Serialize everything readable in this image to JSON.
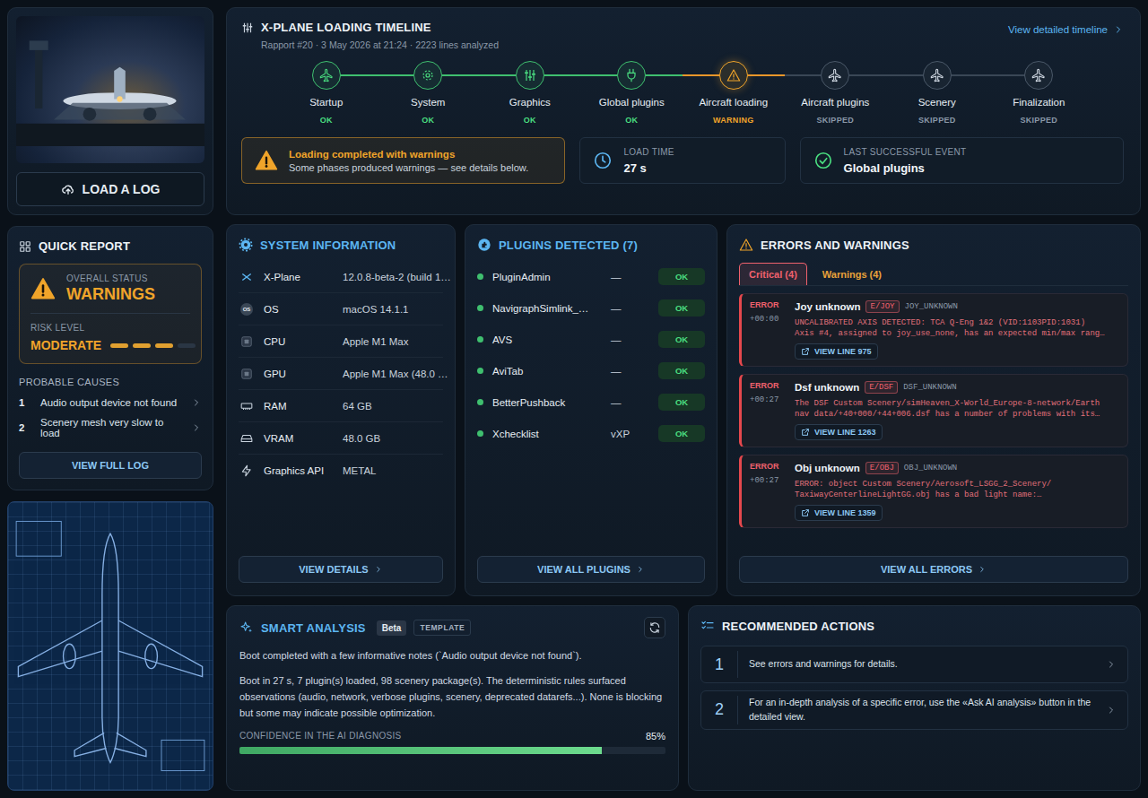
{
  "load_button": {
    "label": "LOAD A LOG"
  },
  "timeline": {
    "title": "X-PLANE LOADING TIMELINE",
    "subtitle": "Rapport #20 · 3 May 2026 at 21:24 · 2223 lines analyzed",
    "link": "View detailed timeline",
    "steps": [
      {
        "label": "Startup",
        "status": "OK",
        "kind": "ok"
      },
      {
        "label": "System",
        "status": "OK",
        "kind": "ok"
      },
      {
        "label": "Graphics",
        "status": "OK",
        "kind": "ok"
      },
      {
        "label": "Global plugins",
        "status": "OK",
        "kind": "ok"
      },
      {
        "label": "Aircraft loading",
        "status": "WARNING",
        "kind": "warning"
      },
      {
        "label": "Aircraft plugins",
        "status": "SKIPPED",
        "kind": "skipped"
      },
      {
        "label": "Scenery",
        "status": "SKIPPED",
        "kind": "skipped"
      },
      {
        "label": "Finalization",
        "status": "SKIPPED",
        "kind": "skipped"
      }
    ],
    "summary": {
      "title": "Loading completed with warnings",
      "text": "Some phases produced warnings — see details below."
    },
    "load_time": {
      "label": "LOAD TIME",
      "value": "27 s"
    },
    "last_event": {
      "label": "LAST SUCCESSFUL EVENT",
      "value": "Global plugins"
    }
  },
  "quick_report": {
    "title": "QUICK REPORT",
    "status_label": "OVERALL STATUS",
    "status": "WARNINGS",
    "risk_label": "RISK LEVEL",
    "risk": "MODERATE",
    "risk_level": 0.75,
    "causes_title": "PROBABLE CAUSES",
    "causes": [
      {
        "num": "1",
        "text": "Audio output device not found"
      },
      {
        "num": "2",
        "text": "Scenery mesh very slow to load"
      }
    ],
    "button": "VIEW FULL LOG"
  },
  "system": {
    "title": "SYSTEM INFORMATION",
    "rows": [
      {
        "label": "X-Plane",
        "value": "12.0.8-beta-2 (build 1…",
        "kind": "xplane",
        "icon_text": ""
      },
      {
        "label": "OS",
        "value": "macOS 14.1.1",
        "kind": "os",
        "icon_text": "OS"
      },
      {
        "label": "CPU",
        "value": "Apple M1 Max",
        "kind": "chip",
        "icon_text": ""
      },
      {
        "label": "GPU",
        "value": "Apple M1 Max (48.0 …",
        "kind": "chip",
        "icon_text": ""
      },
      {
        "label": "RAM",
        "value": "64 GB",
        "kind": "ram",
        "icon_text": ""
      },
      {
        "label": "VRAM",
        "value": "48.0 GB",
        "kind": "vram",
        "icon_text": ""
      },
      {
        "label": "Graphics API",
        "value": "METAL",
        "kind": "api",
        "icon_text": ""
      }
    ],
    "button": "VIEW DETAILS"
  },
  "plugins": {
    "title": "PLUGINS DETECTED (7)",
    "rows": [
      {
        "name": "PluginAdmin",
        "version": "—",
        "status": "OK",
        "enabled": true
      },
      {
        "name": "NavigraphSimlink_…",
        "version": "—",
        "status": "OK",
        "enabled": true
      },
      {
        "name": "AVS",
        "version": "—",
        "status": "OK",
        "enabled": true
      },
      {
        "name": "AviTab",
        "version": "—",
        "status": "OK",
        "enabled": true
      },
      {
        "name": "BetterPushback",
        "version": "—",
        "status": "OK",
        "enabled": true
      },
      {
        "name": "Xchecklist",
        "version": "vXP",
        "status": "OK",
        "enabled": true
      }
    ],
    "button": "VIEW ALL PLUGINS"
  },
  "errors": {
    "title": "ERRORS AND WARNINGS",
    "tabs": [
      {
        "label": "Critical (4)",
        "selected": true,
        "color": "#f0616d"
      },
      {
        "label": "Warnings (4)",
        "selected": false,
        "color": "#e8a23a"
      }
    ],
    "items": [
      {
        "level": "ERROR",
        "time": "+00:00",
        "title": "Joy unknown",
        "tag": "E/JOY",
        "code": "JOY_UNKNOWN",
        "message": [
          "UNCALIBRATED AXIS DETECTED: TCA Q-Eng 1&2 (VID:1103PID:1031)",
          "Axis #4, assigned to joy_use_none, has an expected min/max rang…"
        ],
        "link": "VIEW LINE 975"
      },
      {
        "level": "ERROR",
        "time": "+00:27",
        "title": "Dsf unknown",
        "tag": "E/DSF",
        "code": "DSF_UNKNOWN",
        "message": [
          "The DSF Custom Scenery/simHeaven_X-World_Europe-8-network/Earth",
          "nav data/+40+000/+44+006.dsf has a number of problems with its…"
        ],
        "link": "VIEW LINE 1263"
      },
      {
        "level": "ERROR",
        "time": "+00:27",
        "title": "Obj unknown",
        "tag": "E/OBJ",
        "code": "OBJ_UNKNOWN",
        "message": [
          "ERROR: object Custom Scenery/Aerosoft_LSGG_2_Scenery/",
          "TaxiwayCenterlineLightGG.obj has a bad light name:…"
        ],
        "link": "VIEW LINE 1359"
      }
    ],
    "button": "VIEW ALL ERRORS"
  },
  "smart": {
    "title": "SMART ANALYSIS",
    "badge": "Beta",
    "tag": "TEMPLATE",
    "paragraphs": [
      "Boot completed with a few informative notes (`Audio output device not found`).",
      "Boot in 27 s, 7 plugin(s) loaded, 98 scenery package(s). The deterministic rules surfaced observations (audio, network, verbose plugins, scenery, deprecated datarefs...). None is blocking but some may indicate possible optimization."
    ],
    "confidence_label": "CONFIDENCE IN THE AI DIAGNOSIS",
    "confidence": "85%",
    "level": 0.85
  },
  "actions": {
    "title": "RECOMMENDED ACTIONS",
    "items": [
      {
        "num": "1",
        "text": "See errors and warnings for details."
      },
      {
        "num": "2",
        "text": "For an in-depth analysis of a specific error, use the «Ask AI analysis» button in the detailed view."
      }
    ]
  }
}
